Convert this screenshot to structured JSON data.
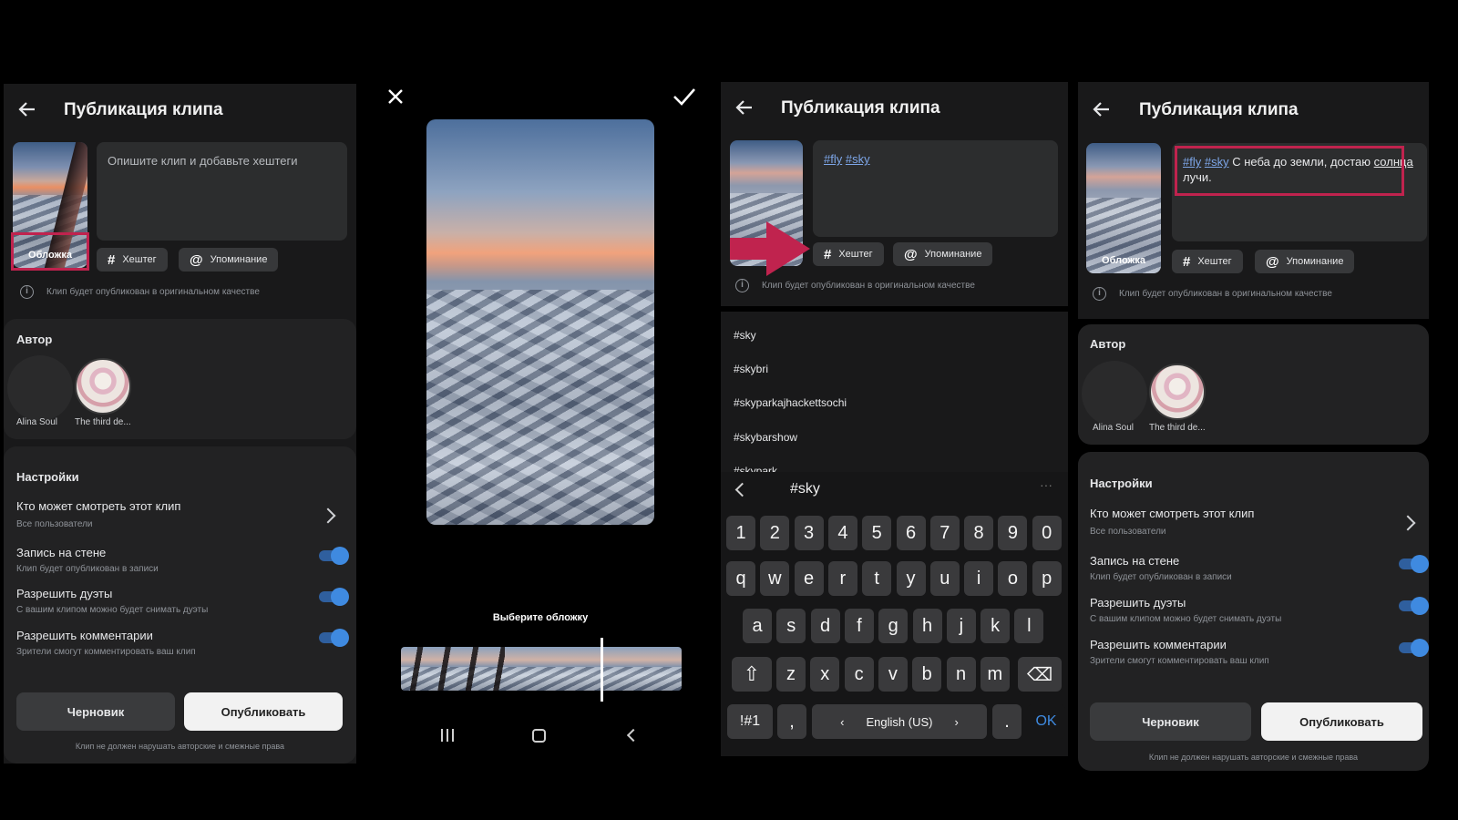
{
  "colors": {
    "accent": "#3f8ae0",
    "annotation": "#c0234e",
    "hashtag": "#7da6e8"
  },
  "publish": {
    "title": "Публикация клипа",
    "placeholder": "Опишите клип и добавьте хештеги",
    "cover_label": "Обложка",
    "chip_hashtag": "Хештег",
    "chip_mention": "Упоминание",
    "quality_note": "Клип будет опубликован в оригинальном качестве",
    "author_header": "Автор",
    "authors": [
      "Alina Soul",
      "The third de..."
    ],
    "settings_header": "Настройки",
    "who_can_watch": "Кто может смотреть этот клип",
    "who_can_watch_value": "Все пользователи",
    "wall_post": "Запись на стене",
    "wall_post_sub": "Клип будет опубликован в записи",
    "duets": "Разрешить дуэты",
    "duets_sub": "С вашим клипом можно будет снимать дуэты",
    "comments": "Разрешить комментарии",
    "comments_sub": "Зрители смогут комментировать ваш клип",
    "draft": "Черновик",
    "publish": "Опубликовать",
    "copyright": "Клип не должен нарушать авторские и смежные права"
  },
  "cover_picker": {
    "prompt": "Выберите обложку"
  },
  "panel3": {
    "tags": [
      "#fly",
      "#sky"
    ],
    "suggestions": [
      "#sky",
      "#skybri",
      "#skyparkajhackettsochi",
      "#skybarshow",
      "#skypark"
    ],
    "keyboard_input": "#sky",
    "row_numbers": [
      "1",
      "2",
      "3",
      "4",
      "5",
      "6",
      "7",
      "8",
      "9",
      "0"
    ],
    "row_q": [
      "q",
      "w",
      "e",
      "r",
      "t",
      "y",
      "u",
      "i",
      "o",
      "p"
    ],
    "row_a": [
      "a",
      "s",
      "d",
      "f",
      "g",
      "h",
      "j",
      "k",
      "l"
    ],
    "row_z": [
      "z",
      "x",
      "c",
      "v",
      "b",
      "n",
      "m"
    ],
    "sym_key": "!#1",
    "comma": ",",
    "language": "English (US)",
    "period": ".",
    "ok": "OK"
  },
  "panel4": {
    "tags": [
      "#fly",
      "#sky"
    ],
    "desc_mid": " С неба до земли, достаю ",
    "desc_word": "солнца",
    "desc_end": " лучи."
  }
}
